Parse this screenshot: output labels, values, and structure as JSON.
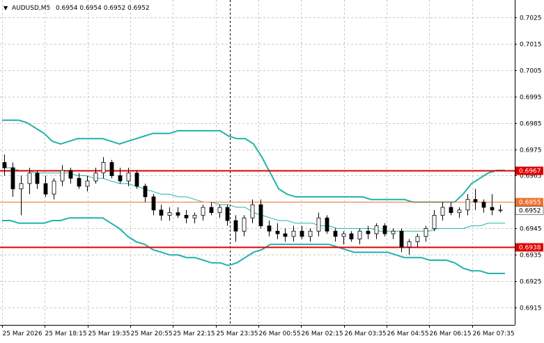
{
  "header": {
    "dropdown_arrow": "▼",
    "symbol": "AUDUSD,M5",
    "ohlc": "0.6954 0.6954 0.6952 0.6952"
  },
  "colors": {
    "background": "#ffffff",
    "grid": "#c8c8c8",
    "axis": "#000000",
    "bands": "#20b2aa",
    "candle_bull": "#ffffff",
    "candle_bear": "#000000",
    "level_line": "#e00000",
    "price_line": "#f07030",
    "price_label_bg": "#f07030"
  },
  "chart_data": {
    "type": "candlestick",
    "symbol": "AUDUSD",
    "timeframe": "M5",
    "ylim": [
      0.69085,
      0.70315
    ],
    "y_ticks": [
      "0.7025",
      "0.7015",
      "0.7005",
      "0.6995",
      "0.6985",
      "0.6975",
      "0.6965",
      "0.6955",
      "0.6945",
      "0.6935",
      "0.6925",
      "0.6915"
    ],
    "x_labels": [
      "25 Mar 2026",
      "25 Mar 18:15",
      "25 Mar 19:35",
      "25 Mar 20:55",
      "25 Mar 22:15",
      "25 Mar 23:35",
      "26 Mar 00:55",
      "26 Mar 02:15",
      "26 Mar 03:35",
      "26 Mar 04:55",
      "26 Mar 06:15",
      "26 Mar 07:35"
    ],
    "grid": true,
    "session_separator_label": "25 Mar 23:35",
    "levels": [
      {
        "price": 0.6967,
        "label": "0.6967"
      },
      {
        "price": 0.6938,
        "label": "0.6938"
      }
    ],
    "current_price": {
      "price": 0.6952,
      "label": "0.6952"
    },
    "orange_level": {
      "price": 0.6955,
      "label": "0.6955"
    },
    "bollinger": {
      "upper": [
        0.6986,
        0.6986,
        0.6986,
        0.6985,
        0.6983,
        0.6981,
        0.6978,
        0.6977,
        0.6978,
        0.6979,
        0.6979,
        0.6979,
        0.6979,
        0.6978,
        0.6977,
        0.6978,
        0.6979,
        0.698,
        0.6981,
        0.6981,
        0.6981,
        0.6982,
        0.6982,
        0.6982,
        0.6982,
        0.6982,
        0.6982,
        0.698,
        0.6979,
        0.6979,
        0.6977,
        0.6972,
        0.6966,
        0.696,
        0.6958,
        0.6957,
        0.6957,
        0.6957,
        0.6957,
        0.6957,
        0.6957,
        0.6957,
        0.6957,
        0.6957,
        0.6956,
        0.6956,
        0.6956,
        0.6956,
        0.6956,
        0.6955,
        0.6955,
        0.6955,
        0.6955,
        0.6955,
        0.6955,
        0.6958,
        0.6962,
        0.6964,
        0.6966,
        0.6967,
        0.6967
      ],
      "middle": [
        0.6968,
        0.6968,
        0.6967,
        0.6967,
        0.6966,
        0.6966,
        0.6966,
        0.6966,
        0.6966,
        0.6965,
        0.6965,
        0.6964,
        0.6964,
        0.6963,
        0.6962,
        0.6962,
        0.6961,
        0.696,
        0.6959,
        0.6958,
        0.6958,
        0.6957,
        0.6957,
        0.6956,
        0.6955,
        0.6955,
        0.6954,
        0.6954,
        0.6953,
        0.6953,
        0.6951,
        0.695,
        0.6949,
        0.6948,
        0.6948,
        0.6947,
        0.6947,
        0.6947,
        0.6946,
        0.6946,
        0.6945,
        0.6945,
        0.6945,
        0.6945,
        0.6945,
        0.6944,
        0.6944,
        0.6944,
        0.6944,
        0.6944,
        0.6944,
        0.6944,
        0.6945,
        0.6945,
        0.6945,
        0.6945,
        0.6946,
        0.6946,
        0.6947,
        0.6947,
        0.6947
      ],
      "lower": [
        0.6948,
        0.6948,
        0.6947,
        0.6947,
        0.6947,
        0.6947,
        0.6948,
        0.6948,
        0.6949,
        0.6949,
        0.6949,
        0.6949,
        0.6949,
        0.6947,
        0.6945,
        0.6942,
        0.694,
        0.6939,
        0.6937,
        0.6936,
        0.6935,
        0.6935,
        0.6934,
        0.6934,
        0.6933,
        0.6932,
        0.6932,
        0.6931,
        0.6932,
        0.6934,
        0.6936,
        0.6937,
        0.6939,
        0.6939,
        0.6939,
        0.6939,
        0.6939,
        0.6939,
        0.6939,
        0.6939,
        0.6938,
        0.6937,
        0.6936,
        0.6936,
        0.6936,
        0.6936,
        0.6936,
        0.6935,
        0.6934,
        0.6934,
        0.6934,
        0.6933,
        0.6933,
        0.6933,
        0.6932,
        0.693,
        0.6929,
        0.6929,
        0.6928,
        0.6928,
        0.6928
      ]
    },
    "candles": [
      [
        0.697,
        0.6973,
        0.6965,
        0.6968
      ],
      [
        0.6968,
        0.697,
        0.6957,
        0.696
      ],
      [
        0.696,
        0.6965,
        0.695,
        0.6962
      ],
      [
        0.6962,
        0.6968,
        0.6958,
        0.6966
      ],
      [
        0.6966,
        0.6967,
        0.696,
        0.6962
      ],
      [
        0.6962,
        0.6965,
        0.6957,
        0.6958
      ],
      [
        0.6958,
        0.6964,
        0.6956,
        0.6963
      ],
      [
        0.6963,
        0.6969,
        0.6961,
        0.6967
      ],
      [
        0.6967,
        0.6968,
        0.6962,
        0.6964
      ],
      [
        0.6964,
        0.6966,
        0.696,
        0.6961
      ],
      [
        0.6961,
        0.6965,
        0.6959,
        0.6963
      ],
      [
        0.6963,
        0.6968,
        0.6962,
        0.6966
      ],
      [
        0.6966,
        0.6972,
        0.6964,
        0.697
      ],
      [
        0.697,
        0.6971,
        0.6964,
        0.6965
      ],
      [
        0.6965,
        0.6968,
        0.6962,
        0.6963
      ],
      [
        0.6963,
        0.6968,
        0.6961,
        0.6966
      ],
      [
        0.6966,
        0.6967,
        0.696,
        0.6961
      ],
      [
        0.6961,
        0.6962,
        0.6955,
        0.6957
      ],
      [
        0.6957,
        0.6958,
        0.695,
        0.6952
      ],
      [
        0.6952,
        0.6954,
        0.6948,
        0.695
      ],
      [
        0.695,
        0.6953,
        0.6948,
        0.6951
      ],
      [
        0.6951,
        0.6953,
        0.6949,
        0.695
      ],
      [
        0.695,
        0.6952,
        0.6947,
        0.6949
      ],
      [
        0.6949,
        0.6951,
        0.6947,
        0.695
      ],
      [
        0.695,
        0.6954,
        0.6948,
        0.6953
      ],
      [
        0.6953,
        0.6955,
        0.695,
        0.6951
      ],
      [
        0.6951,
        0.6954,
        0.6949,
        0.6953
      ],
      [
        0.6953,
        0.6954,
        0.6946,
        0.6948
      ],
      [
        0.6948,
        0.695,
        0.694,
        0.6944
      ],
      [
        0.6944,
        0.695,
        0.6942,
        0.6949
      ],
      [
        0.6949,
        0.6956,
        0.6947,
        0.6954
      ],
      [
        0.6954,
        0.6956,
        0.6945,
        0.6946
      ],
      [
        0.6946,
        0.6948,
        0.6942,
        0.6944
      ],
      [
        0.6944,
        0.6947,
        0.6941,
        0.6943
      ],
      [
        0.6943,
        0.6945,
        0.694,
        0.6942
      ],
      [
        0.6942,
        0.6946,
        0.694,
        0.6944
      ],
      [
        0.6944,
        0.6946,
        0.6941,
        0.6942
      ],
      [
        0.6942,
        0.6945,
        0.694,
        0.6944
      ],
      [
        0.6944,
        0.6951,
        0.6942,
        0.6949
      ],
      [
        0.6949,
        0.695,
        0.6943,
        0.6944
      ],
      [
        0.6944,
        0.6945,
        0.694,
        0.6942
      ],
      [
        0.6942,
        0.6944,
        0.6939,
        0.6943
      ],
      [
        0.6943,
        0.6944,
        0.694,
        0.6941
      ],
      [
        0.6941,
        0.6945,
        0.6939,
        0.6944
      ],
      [
        0.6944,
        0.6946,
        0.6941,
        0.6943
      ],
      [
        0.6943,
        0.6947,
        0.6941,
        0.6946
      ],
      [
        0.6946,
        0.6947,
        0.6942,
        0.6943
      ],
      [
        0.6943,
        0.6945,
        0.6941,
        0.6944
      ],
      [
        0.6944,
        0.6945,
        0.6936,
        0.6938
      ],
      [
        0.6938,
        0.6941,
        0.6935,
        0.694
      ],
      [
        0.694,
        0.6943,
        0.6938,
        0.6942
      ],
      [
        0.6942,
        0.6946,
        0.694,
        0.6945
      ],
      [
        0.6945,
        0.6952,
        0.6944,
        0.695
      ],
      [
        0.695,
        0.6955,
        0.6948,
        0.6953
      ],
      [
        0.6953,
        0.6955,
        0.695,
        0.6951
      ],
      [
        0.6951,
        0.6953,
        0.6949,
        0.6952
      ],
      [
        0.6952,
        0.6958,
        0.695,
        0.6956
      ],
      [
        0.6956,
        0.696,
        0.6952,
        0.6955
      ],
      [
        0.6955,
        0.6956,
        0.6951,
        0.6953
      ],
      [
        0.6953,
        0.6958,
        0.695,
        0.6952
      ],
      [
        0.6952,
        0.6954,
        0.6951,
        0.6952
      ]
    ]
  }
}
